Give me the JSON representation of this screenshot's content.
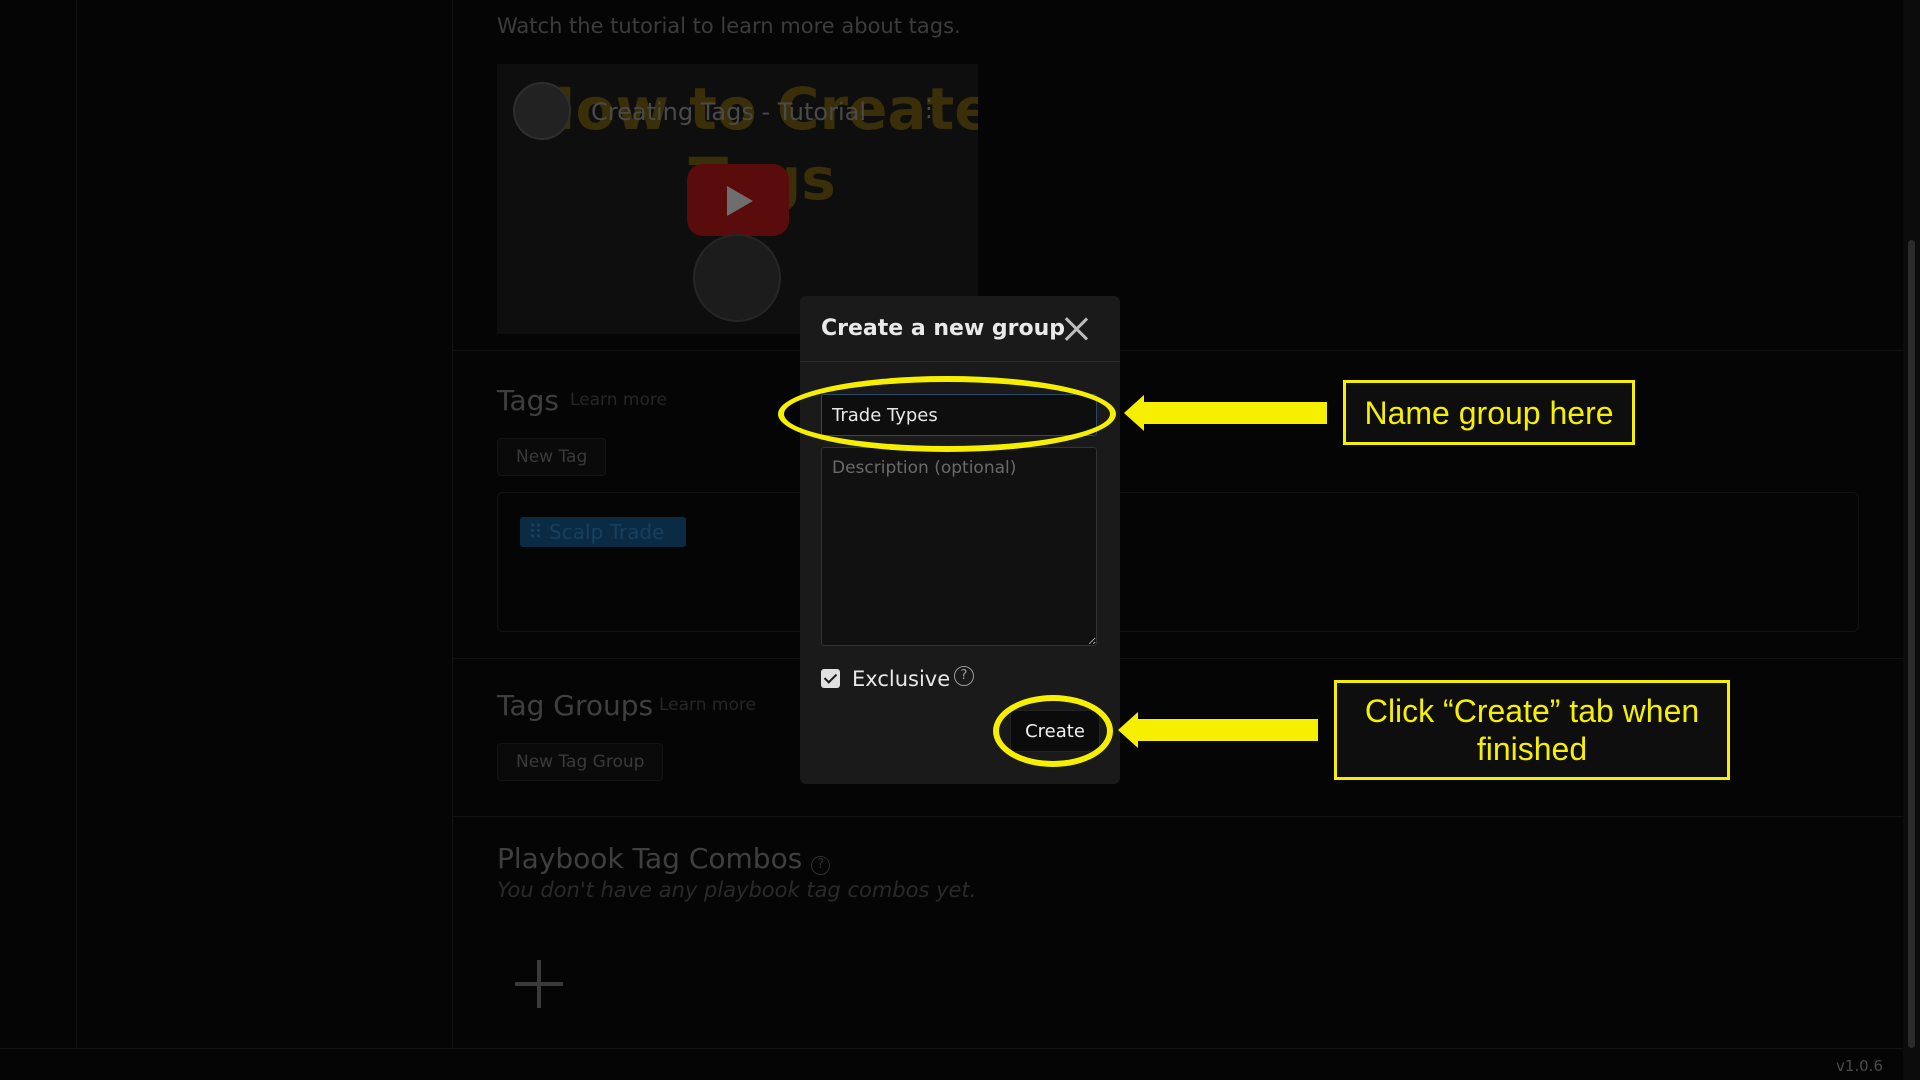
{
  "intro_text": "Watch the tutorial to learn more about tags.",
  "video": {
    "title": "Creating Tags - Tutorial",
    "bg_text": "How to Create\n        Tags",
    "menu_icon": "more-vertical-icon",
    "play_icon": "play-icon"
  },
  "tags": {
    "title": "Tags",
    "learn_more": "Learn more",
    "new_button": "New Tag",
    "chip": "⠿ Scalp Trade"
  },
  "tag_groups": {
    "title": "Tag Groups",
    "learn_more": "Learn more",
    "new_button": "New Tag Group"
  },
  "combos": {
    "title": "Playbook Tag Combos",
    "empty": "You don't have any playbook tag combos yet.",
    "help": "?"
  },
  "version": "v1.0.6",
  "modal": {
    "title": "Create a new group",
    "name_value": "Trade Types",
    "description_placeholder": "Description (optional)",
    "exclusive_label": "Exclusive",
    "exclusive_checked": true,
    "help": "?",
    "create_label": "Create"
  },
  "annotations": {
    "name_callout": "Name group here",
    "create_callout": "Click “Create” tab when finished",
    "color": "#f6f000"
  }
}
